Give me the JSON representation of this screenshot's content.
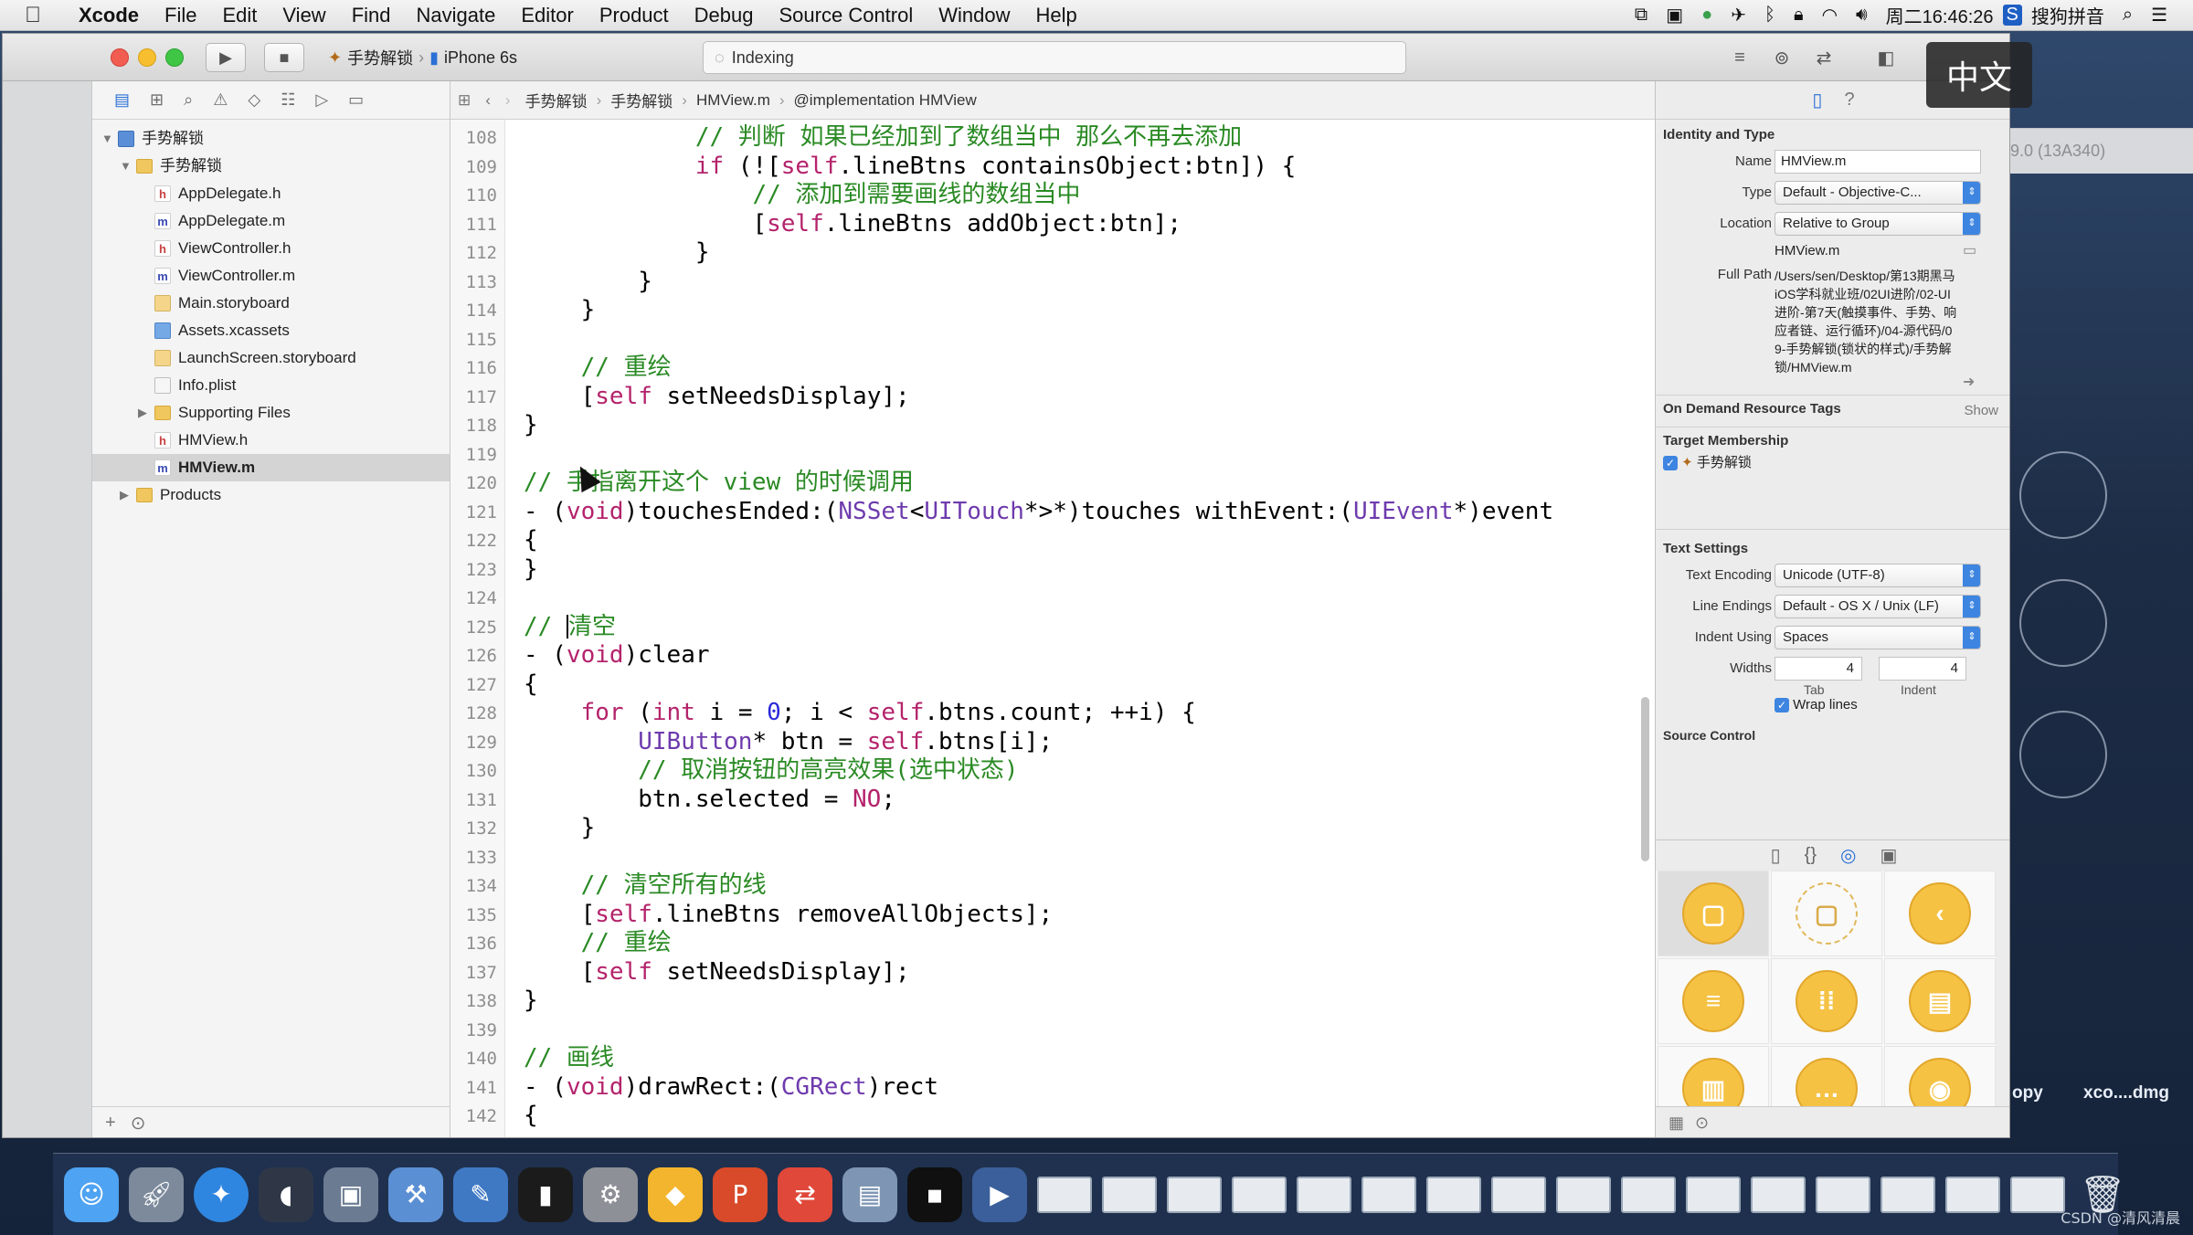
{
  "menubar": {
    "app_name": "Xcode",
    "items": [
      "File",
      "Edit",
      "View",
      "Find",
      "Navigate",
      "Editor",
      "Product",
      "Debug",
      "Source Control",
      "Window",
      "Help"
    ],
    "clock": "周二16:46:26",
    "input_method": "搜狗拼音"
  },
  "toolbar": {
    "scheme_target": "手势解锁",
    "scheme_device": "iPhone 6s",
    "activity_text": "Indexing",
    "overlay_badge": "中文"
  },
  "jumpbar": {
    "path": [
      "手势解锁",
      "手势解锁",
      "HMView.m",
      "@implementation HMView"
    ]
  },
  "navigator": {
    "tree": [
      {
        "label": "手势解锁",
        "icon": "project-icon",
        "depth": 0,
        "disclosure": "open"
      },
      {
        "label": "手势解锁",
        "icon": "folder-icon",
        "depth": 1,
        "disclosure": "open"
      },
      {
        "label": "AppDelegate.h",
        "icon": "h-file-icon",
        "depth": 2
      },
      {
        "label": "AppDelegate.m",
        "icon": "m-file-icon",
        "depth": 2
      },
      {
        "label": "ViewController.h",
        "icon": "h-file-icon",
        "depth": 2
      },
      {
        "label": "ViewController.m",
        "icon": "m-file-icon",
        "depth": 2
      },
      {
        "label": "Main.storyboard",
        "icon": "storyboard-icon",
        "depth": 2
      },
      {
        "label": "Assets.xcassets",
        "icon": "xcassets-icon",
        "depth": 2
      },
      {
        "label": "LaunchScreen.storyboard",
        "icon": "storyboard-icon",
        "depth": 2
      },
      {
        "label": "Info.plist",
        "icon": "plist-icon",
        "depth": 2
      },
      {
        "label": "Supporting Files",
        "icon": "folder-icon",
        "depth": 2,
        "disclosure": "closed"
      },
      {
        "label": "HMView.h",
        "icon": "h-file-icon",
        "depth": 2
      },
      {
        "label": "HMView.m",
        "icon": "m-file-icon",
        "depth": 2,
        "selected": true
      },
      {
        "label": "Products",
        "icon": "folder-icon",
        "depth": 1,
        "disclosure": "closed"
      }
    ]
  },
  "editor": {
    "line_numbers": [
      "108",
      "109",
      "110",
      "111",
      "112",
      "113",
      "114",
      "115",
      "116",
      "117",
      "118",
      "119",
      "120",
      "121",
      "122",
      "123",
      "124",
      "125",
      "126",
      "127",
      "128",
      "129",
      "130",
      "131",
      "132",
      "133",
      "134",
      "135",
      "136",
      "137",
      "138",
      "139",
      "140",
      "141",
      "142"
    ],
    "lines": [
      [
        {
          "t": "            ",
          "c": ""
        },
        {
          "t": "// 判断 如果已经加到了数组当中 那么不再去添加",
          "c": "cmt"
        }
      ],
      [
        {
          "t": "            ",
          "c": ""
        },
        {
          "t": "if",
          "c": "kw"
        },
        {
          "t": " (![",
          "c": ""
        },
        {
          "t": "self",
          "c": "kw"
        },
        {
          "t": ".lineBtns containsObject:btn]) {",
          "c": ""
        }
      ],
      [
        {
          "t": "                ",
          "c": ""
        },
        {
          "t": "// 添加到需要画线的数组当中",
          "c": "cmt"
        }
      ],
      [
        {
          "t": "                [",
          "c": ""
        },
        {
          "t": "self",
          "c": "kw"
        },
        {
          "t": ".lineBtns addObject:btn];",
          "c": ""
        }
      ],
      [
        {
          "t": "            }",
          "c": ""
        }
      ],
      [
        {
          "t": "        }",
          "c": ""
        }
      ],
      [
        {
          "t": "    }",
          "c": ""
        }
      ],
      [
        {
          "t": "",
          "c": ""
        }
      ],
      [
        {
          "t": "    ",
          "c": ""
        },
        {
          "t": "// 重绘",
          "c": "cmt"
        }
      ],
      [
        {
          "t": "    [",
          "c": ""
        },
        {
          "t": "self",
          "c": "kw"
        },
        {
          "t": " setNeedsDisplay];",
          "c": ""
        }
      ],
      [
        {
          "t": "}",
          "c": ""
        }
      ],
      [
        {
          "t": "",
          "c": ""
        }
      ],
      [
        {
          "t": "// 手指离开这个 view 的时候调用",
          "c": "cmt"
        }
      ],
      [
        {
          "t": "- (",
          "c": ""
        },
        {
          "t": "void",
          "c": "kw"
        },
        {
          "t": ")touchesEnded:(",
          "c": ""
        },
        {
          "t": "NSSet",
          "c": "cls"
        },
        {
          "t": "<",
          "c": ""
        },
        {
          "t": "UITouch",
          "c": "cls"
        },
        {
          "t": "*>*)touches withEvent:(",
          "c": ""
        },
        {
          "t": "UIEvent",
          "c": "cls"
        },
        {
          "t": "*)event",
          "c": ""
        }
      ],
      [
        {
          "t": "{",
          "c": ""
        }
      ],
      [
        {
          "t": "}",
          "c": ""
        }
      ],
      [
        {
          "t": "",
          "c": ""
        }
      ],
      [
        {
          "t": "// ",
          "c": "cmt"
        },
        {
          "t": "|CARET|",
          "c": "caret"
        },
        {
          "t": "清空",
          "c": "cmt"
        }
      ],
      [
        {
          "t": "- (",
          "c": ""
        },
        {
          "t": "void",
          "c": "kw"
        },
        {
          "t": ")clear",
          "c": ""
        }
      ],
      [
        {
          "t": "{",
          "c": ""
        }
      ],
      [
        {
          "t": "    ",
          "c": ""
        },
        {
          "t": "for",
          "c": "kw"
        },
        {
          "t": " (",
          "c": ""
        },
        {
          "t": "int",
          "c": "kw"
        },
        {
          "t": " i = ",
          "c": ""
        },
        {
          "t": "0",
          "c": "num"
        },
        {
          "t": "; i < ",
          "c": ""
        },
        {
          "t": "self",
          "c": "kw"
        },
        {
          "t": ".btns.count; ++i) {",
          "c": ""
        }
      ],
      [
        {
          "t": "        ",
          "c": ""
        },
        {
          "t": "UIButton",
          "c": "cls"
        },
        {
          "t": "* btn = ",
          "c": ""
        },
        {
          "t": "self",
          "c": "kw"
        },
        {
          "t": ".btns[i];",
          "c": ""
        }
      ],
      [
        {
          "t": "        ",
          "c": ""
        },
        {
          "t": "// 取消按钮的高亮效果(选中状态)",
          "c": "cmt"
        }
      ],
      [
        {
          "t": "        btn.selected = ",
          "c": ""
        },
        {
          "t": "NO",
          "c": "kw"
        },
        {
          "t": ";",
          "c": ""
        }
      ],
      [
        {
          "t": "    }",
          "c": ""
        }
      ],
      [
        {
          "t": "",
          "c": ""
        }
      ],
      [
        {
          "t": "    ",
          "c": ""
        },
        {
          "t": "// 清空所有的线",
          "c": "cmt"
        }
      ],
      [
        {
          "t": "    [",
          "c": ""
        },
        {
          "t": "self",
          "c": "kw"
        },
        {
          "t": ".lineBtns removeAllObjects];",
          "c": ""
        }
      ],
      [
        {
          "t": "    ",
          "c": ""
        },
        {
          "t": "// 重绘",
          "c": "cmt"
        }
      ],
      [
        {
          "t": "    [",
          "c": ""
        },
        {
          "t": "self",
          "c": "kw"
        },
        {
          "t": " setNeedsDisplay];",
          "c": ""
        }
      ],
      [
        {
          "t": "}",
          "c": ""
        }
      ],
      [
        {
          "t": "",
          "c": ""
        }
      ],
      [
        {
          "t": "// 画线",
          "c": "cmt"
        }
      ],
      [
        {
          "t": "- (",
          "c": ""
        },
        {
          "t": "void",
          "c": "kw"
        },
        {
          "t": ")drawRect:(",
          "c": ""
        },
        {
          "t": "CGRect",
          "c": "cls"
        },
        {
          "t": ")rect",
          "c": ""
        }
      ],
      [
        {
          "t": "{",
          "c": ""
        }
      ]
    ]
  },
  "inspector": {
    "identity_title": "Identity and Type",
    "name_label": "Name",
    "name_value": "HMView.m",
    "type_label": "Type",
    "type_value": "Default - Objective-C...",
    "location_label": "Location",
    "location_value": "Relative to Group",
    "location_file": "HMView.m",
    "fullpath_label": "Full Path",
    "fullpath_value": "/Users/sen/Desktop/第13期黑马iOS学科就业班/02UI进阶/02-UI进阶-第7天(触摸事件、手势、响应者链、运行循环)/04-源代码/09-手势解锁(锁状的样式)/手势解锁/HMView.m",
    "on_demand_title": "On Demand Resource Tags",
    "on_demand_show": "Show",
    "target_title": "Target Membership",
    "target_item": "手势解锁",
    "text_settings_title": "Text Settings",
    "encoding_label": "Text Encoding",
    "encoding_value": "Unicode (UTF-8)",
    "line_endings_label": "Line Endings",
    "line_endings_value": "Default - OS X / Unix (LF)",
    "indent_using_label": "Indent Using",
    "indent_using_value": "Spaces",
    "widths_label": "Widths",
    "tab_value": "4",
    "indent_value": "4",
    "tab_caption": "Tab",
    "indent_caption": "Indent",
    "wrap_lines_label": "Wrap lines",
    "source_control_title": "Source Control"
  },
  "desktop": {
    "bg_window_text": "9.0 (13A340)",
    "label_copy": "opy",
    "label_dmg": "xco....dmg",
    "watermark": "CSDN @清风清晨"
  },
  "colors": {
    "comment": "#2a8a24",
    "keyword": "#b4236b",
    "number": "#2b29d9",
    "class": "#6e3bad",
    "accent": "#3d85e0",
    "library_icon": "#f5c244"
  }
}
